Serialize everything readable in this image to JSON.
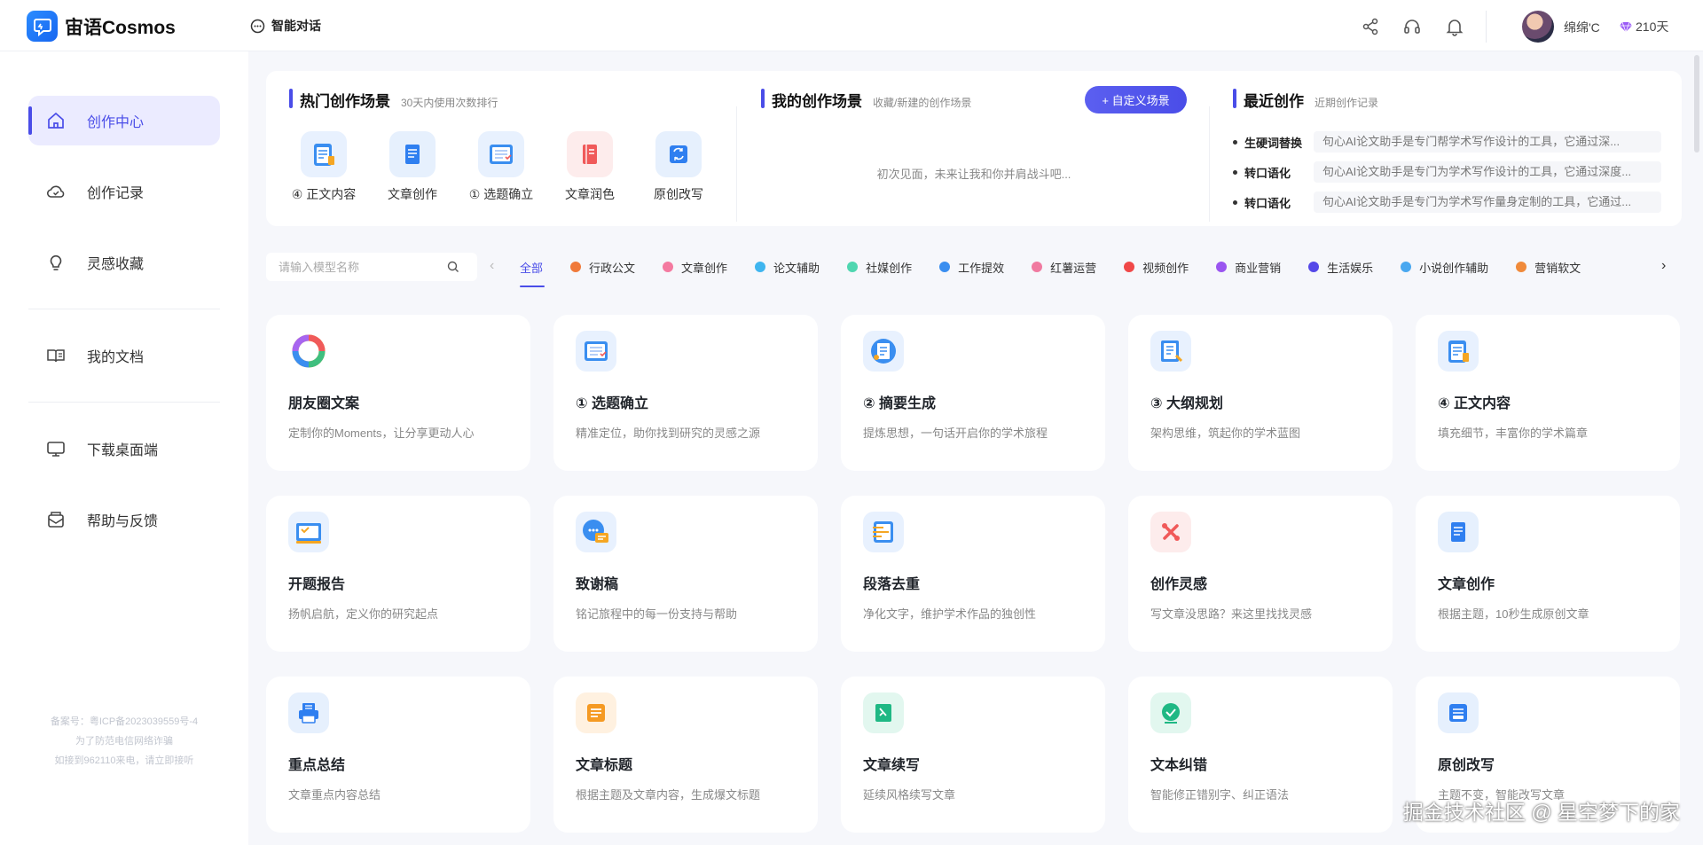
{
  "app": {
    "logo_text": "宙语Cosmos",
    "nav_chat": "智能对话"
  },
  "user": {
    "name": "绵绵'C",
    "days": "210天"
  },
  "sidebar": {
    "items": [
      {
        "label": "创作中心",
        "icon": "home-icon"
      },
      {
        "label": "创作记录",
        "icon": "cloud-icon"
      },
      {
        "label": "灵感收藏",
        "icon": "bulb-icon"
      },
      {
        "label": "我的文档",
        "icon": "book-icon"
      },
      {
        "label": "下载桌面端",
        "icon": "monitor-icon"
      },
      {
        "label": "帮助与反馈",
        "icon": "mail-icon"
      }
    ],
    "footer": [
      "备案号：粤ICP备2023039559号-4",
      "为了防范电信网络诈骗",
      "如接到962110来电，请立即接听"
    ]
  },
  "hot": {
    "title": "热门创作场景",
    "subtitle": "30天内使用次数排行",
    "items": [
      "④ 正文内容",
      "文章创作",
      "① 选题确立",
      "文章润色",
      "原创改写"
    ]
  },
  "mine": {
    "title": "我的创作场景",
    "subtitle": "收藏/新建的创作场景",
    "button": "+ 自定义场景",
    "empty": "初次见面，未来让我和你并肩战斗吧..."
  },
  "recent": {
    "title": "最近创作",
    "subtitle": "近期创作记录",
    "items": [
      {
        "name": "生硬词替换",
        "desc": "句心AI论文助手是专门帮学术写作设计的工具，它通过深..."
      },
      {
        "name": "转口语化",
        "desc": "句心AI论文助手是专门为学术写作设计的工具，它通过深度..."
      },
      {
        "name": "转口语化",
        "desc": "句心AI论文助手是专门为学术写作量身定制的工具，它通过..."
      }
    ]
  },
  "search": {
    "placeholder": "请输入模型名称"
  },
  "tabs": [
    {
      "label": "全部",
      "color": ""
    },
    {
      "label": "行政公文",
      "color": "#f07a3a"
    },
    {
      "label": "文章创作",
      "color": "#f47aa0"
    },
    {
      "label": "论文辅助",
      "color": "#3fb5ef"
    },
    {
      "label": "社媒创作",
      "color": "#4fd6b0"
    },
    {
      "label": "工作提效",
      "color": "#3a8ef0"
    },
    {
      "label": "红薯运营",
      "color": "#f07aa0"
    },
    {
      "label": "视频创作",
      "color": "#f04848"
    },
    {
      "label": "商业营销",
      "color": "#9a55f0"
    },
    {
      "label": "生活娱乐",
      "color": "#5548e8"
    },
    {
      "label": "小说创作辅助",
      "color": "#4aa8f0"
    },
    {
      "label": "营销软文",
      "color": "#f08a3a"
    }
  ],
  "cards": [
    {
      "title": "朋友圈文案",
      "desc": "定制你的Moments，让分享更动人心",
      "icon": "ring-icon",
      "bg": "#ffffff",
      "fg": "#f5a623"
    },
    {
      "title": "① 选题确立",
      "desc": "精准定位，助你找到研究的灵感之源",
      "icon": "checklist-icon",
      "bg": "#e8f1fe",
      "fg": "#3a8ef0"
    },
    {
      "title": "② 摘要生成",
      "desc": "提炼思想，一句话开启你的学术旅程",
      "icon": "document-icon",
      "bg": "#e8f1fe",
      "fg": "#3a8ef0"
    },
    {
      "title": "③ 大纲规划",
      "desc": "架构思维，筑起你的学术蓝图",
      "icon": "outline-icon",
      "bg": "#e8f1fe",
      "fg": "#3a8ef0"
    },
    {
      "title": "④ 正文内容",
      "desc": "填充细节，丰富你的学术篇章",
      "icon": "clipboard-icon",
      "bg": "#e8f1fe",
      "fg": "#3a8ef0"
    },
    {
      "title": "开题报告",
      "desc": "扬帆启航，定义你的研究起点",
      "icon": "report-icon",
      "bg": "#e8f1fe",
      "fg": "#3a8ef0"
    },
    {
      "title": "致谢稿",
      "desc": "铭记旅程中的每一份支持与帮助",
      "icon": "chat-icon",
      "bg": "#e8f1fe",
      "fg": "#3a8ef0"
    },
    {
      "title": "段落去重",
      "desc": "净化文字，维护学术作品的独创性",
      "icon": "paragraph-icon",
      "bg": "#e8f1fe",
      "fg": "#3a8ef0"
    },
    {
      "title": "创作灵感",
      "desc": "写文章没思路？来这里找找灵感",
      "icon": "cross-icon",
      "bg": "#fdecec",
      "fg": "#f05a5a"
    },
    {
      "title": "文章创作",
      "desc": "根据主题，10秒生成原创文章",
      "icon": "article-icon",
      "bg": "#e6f0fd",
      "fg": "#2f7ff0"
    },
    {
      "title": "重点总结",
      "desc": "文章重点内容总结",
      "icon": "printer-icon",
      "bg": "#e6f0fd",
      "fg": "#2f7ff0"
    },
    {
      "title": "文章标题",
      "desc": "根据主题及文章内容，生成爆文标题",
      "icon": "title-icon",
      "bg": "#fff1e0",
      "fg": "#f59a23"
    },
    {
      "title": "文章续写",
      "desc": "延续风格续写文章",
      "icon": "continue-icon",
      "bg": "#e2f7ef",
      "fg": "#1fb884"
    },
    {
      "title": "文本纠错",
      "desc": "智能修正错别字、纠正语法",
      "icon": "check-icon",
      "bg": "#e2f7ef",
      "fg": "#1fb884"
    },
    {
      "title": "原创改写",
      "desc": "主题不变，智能改写文章",
      "icon": "rewrite-icon",
      "bg": "#e6f0fd",
      "fg": "#2f7ff0"
    }
  ],
  "watermark": "掘金技术社区 @ 星空梦下的家"
}
